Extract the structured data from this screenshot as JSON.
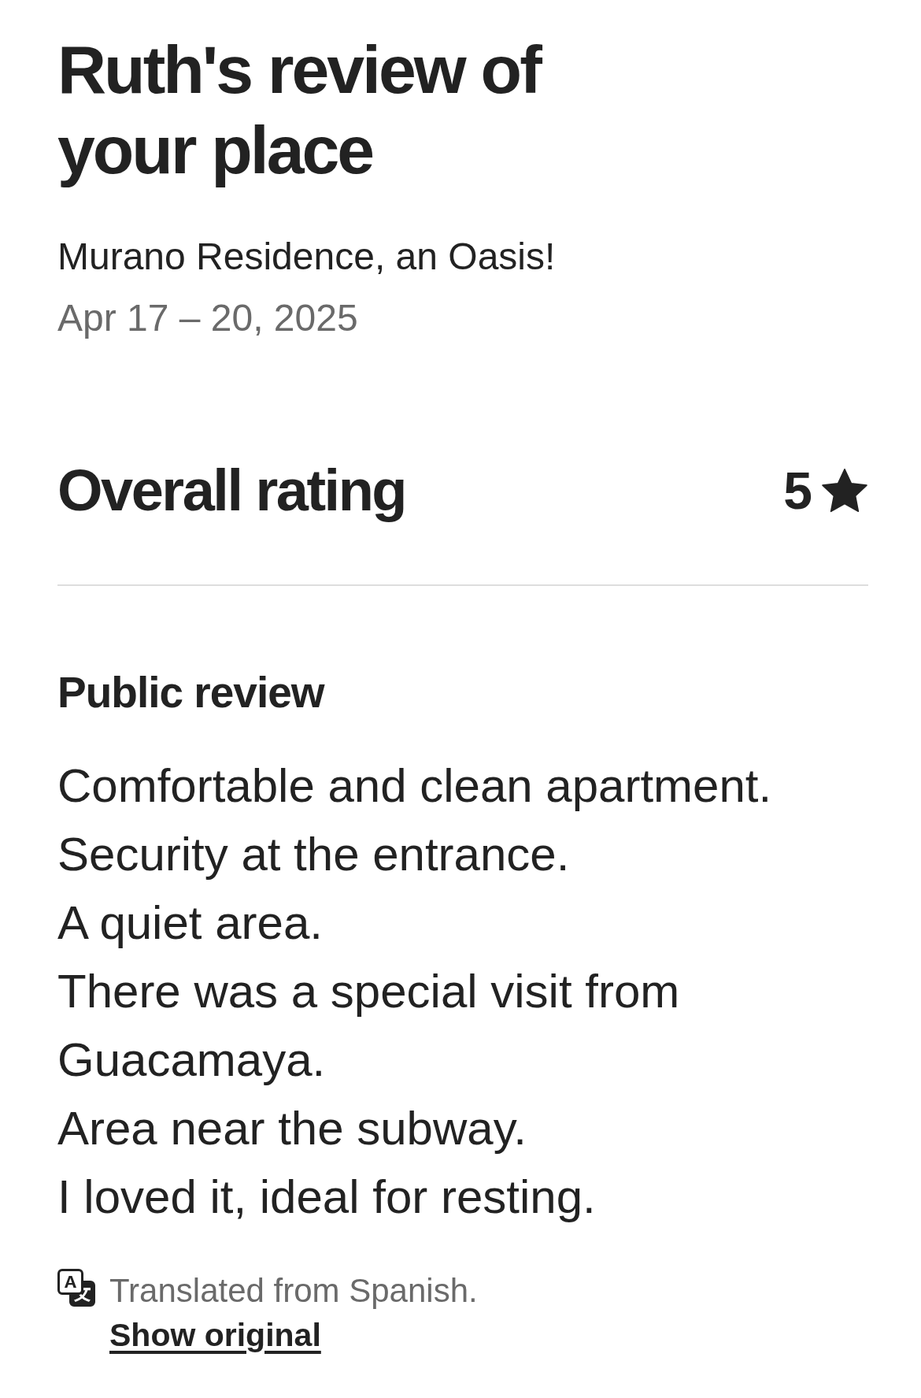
{
  "header": {
    "title": "Ruth's review of your place",
    "listing": "Murano Residence, an Oasis!",
    "dates": "Apr 17 – 20, 2025"
  },
  "overall_rating": {
    "label": "Overall rating",
    "value": "5"
  },
  "public_review": {
    "heading": "Public review",
    "text": "Comfortable and clean apartment.\nSecurity at the entrance.\nA quiet area.\nThere was a special visit from Guacamaya.\nArea near the subway.\nI loved it, ideal for resting."
  },
  "translation": {
    "note": "Translated from Spanish.",
    "link": "Show original"
  }
}
